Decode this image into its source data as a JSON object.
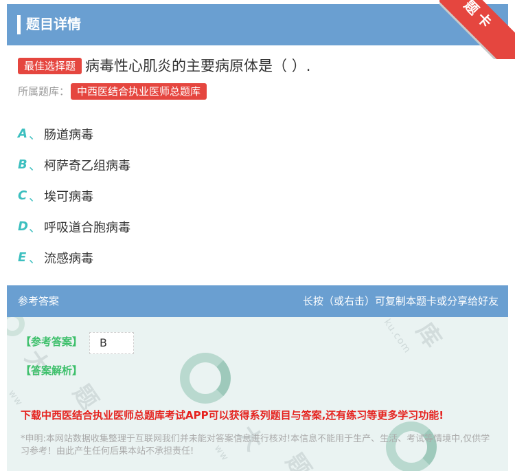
{
  "header": {
    "title": "题目详情",
    "corner_label": "题卡"
  },
  "question": {
    "type_badge": "最佳选择题",
    "text": "病毒性心肌炎的主要病原体是（ ）.",
    "bank_label": "所属题库：",
    "bank_name": "中西医结合执业医师总题库"
  },
  "options": [
    {
      "letter": "A",
      "sep": "、",
      "text": "肠道病毒"
    },
    {
      "letter": "B",
      "sep": "、",
      "text": "柯萨奇乙组病毒"
    },
    {
      "letter": "C",
      "sep": "、",
      "text": "埃可病毒"
    },
    {
      "letter": "D",
      "sep": "、",
      "text": "呼吸道合胞病毒"
    },
    {
      "letter": "E",
      "sep": "、",
      "text": "流感病毒"
    }
  ],
  "answer_section": {
    "title": "参考答案",
    "hint": "长按（或右击）可复制本题卡或分享给好友",
    "answer_label": "【参考答案】",
    "answer_value": "B",
    "analysis_label": "【答案解析】",
    "promo": "下载中西医结合执业医师总题库考试APP可以获得系列题目与答案,还有练习等更多学习功能!",
    "disclaimer": "*申明:本网站数据收集整理于互联网我们并未能对答案信息进行核对!本信息不能用于生产、生活、考试等情境中,仅供学习参考！由此产生任何后果本站不承担责任!"
  },
  "colors": {
    "header_blue": "#6a9fd1",
    "accent_red": "#e5463f",
    "teal": "#3cbfbf",
    "green": "#3cbf6a",
    "promo_red": "#e5231f"
  }
}
